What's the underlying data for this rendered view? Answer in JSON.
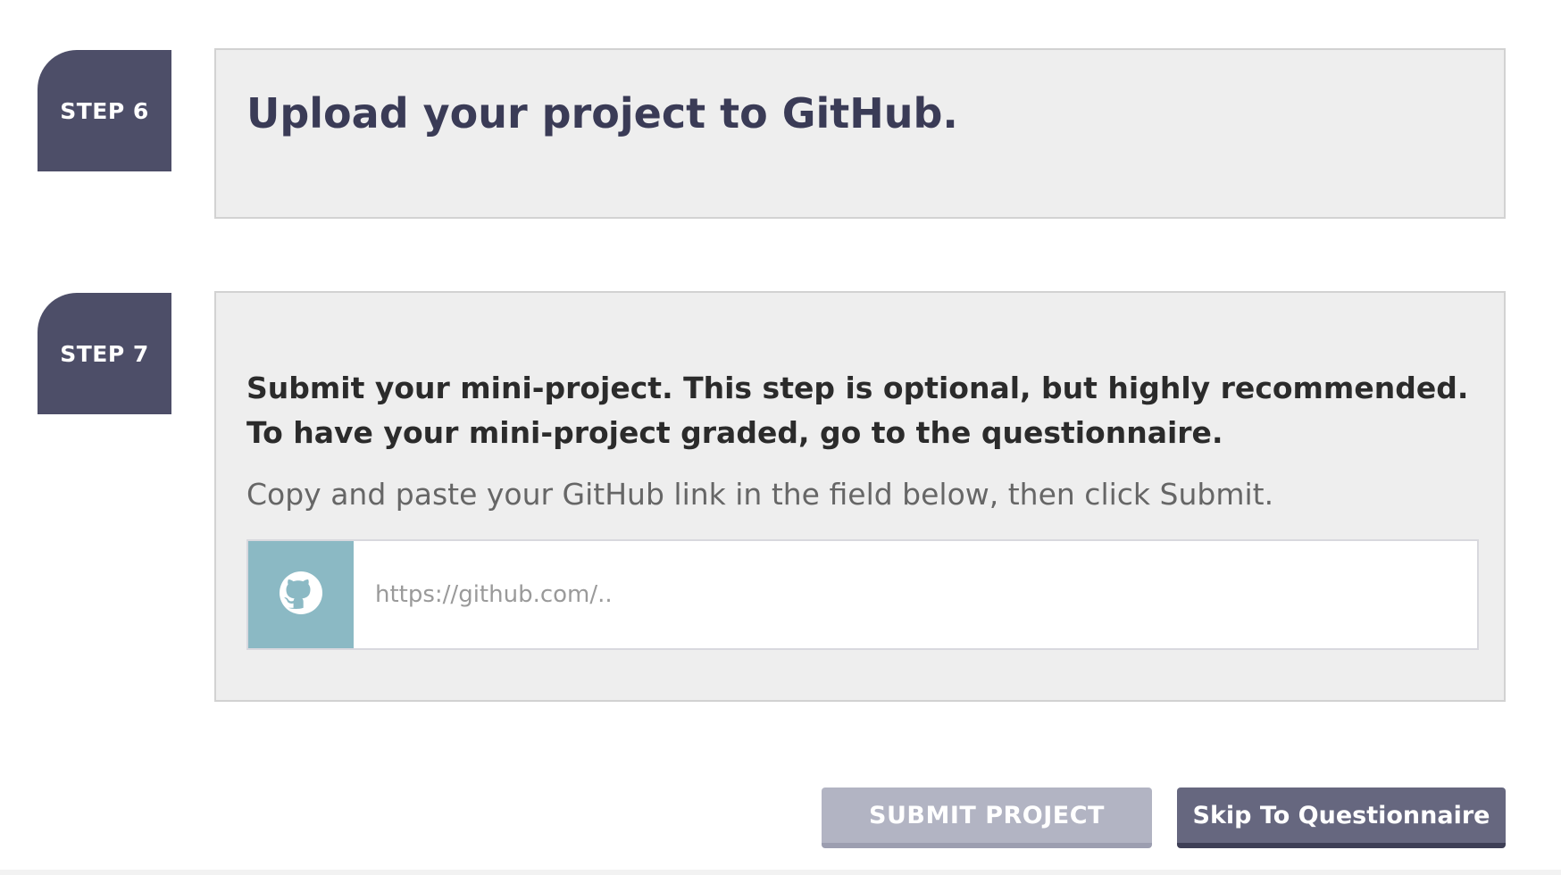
{
  "steps": [
    {
      "badge": "STEP 6",
      "title": "Upload your project to GitHub."
    },
    {
      "badge": "STEP 7",
      "title": "Submit your mini-project. This step is optional, but highly recommended. To have your mini-project graded, go to the questionnaire.",
      "instructions": "Copy and paste your GitHub link in the field below, then click Submit.",
      "input": {
        "value": "",
        "placeholder": "https://github.com/..",
        "icon": "github-icon"
      }
    }
  ],
  "actions": {
    "submit_label": "SUBMIT PROJECT",
    "skip_label": "Skip To Questionnaire"
  },
  "colors": {
    "badge_bg": "#4d4e68",
    "card_bg": "#eeeeee",
    "github_addon_bg": "#8bb9c4",
    "submit_bg": "#b2b4c3",
    "skip_bg": "#66677f",
    "title_text": "#3a3b56"
  }
}
